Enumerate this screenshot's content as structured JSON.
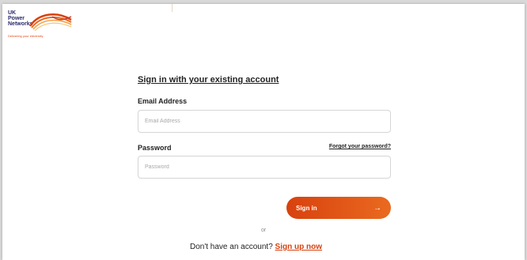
{
  "brand": {
    "name_lines": [
      "UK",
      "Power",
      "Networks"
    ],
    "tagline": "Delivering your electricity",
    "swoosh_colors": [
      "#d8410e",
      "#ea6a1f",
      "#f3a14a",
      "#f7c77a"
    ]
  },
  "form": {
    "heading": "Sign in with your existing account",
    "email_label": "Email Address",
    "email_placeholder": "Email Address",
    "email_value": "",
    "password_label": "Password",
    "password_placeholder": "Password",
    "password_value": "",
    "forgot_link": "Forgot your password?",
    "signin_label": "Sign in",
    "signin_icon": "arrow-right-icon",
    "or_text": "or",
    "signup_prompt": "Don't have an account?",
    "signup_link": "Sign up now"
  },
  "colors": {
    "accent": "#d8410e",
    "accent_end": "#ea6a1f",
    "text": "#222222"
  }
}
